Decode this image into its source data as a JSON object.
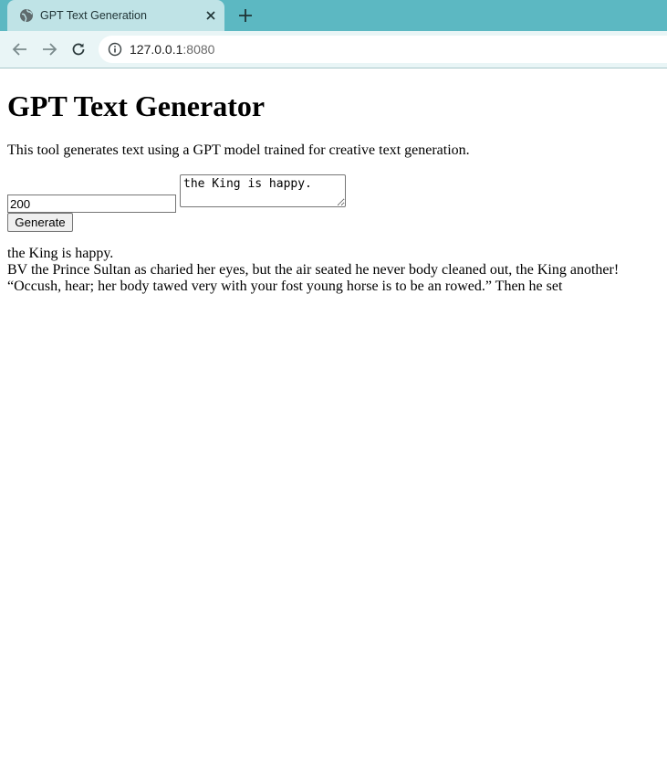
{
  "browser": {
    "tab_title": "GPT Text Generation",
    "url_host": "127.0.0.1",
    "url_port": ":8080"
  },
  "page": {
    "heading": "GPT Text Generator",
    "description": "This tool generates text using a GPT model trained for creative text generation.",
    "form": {
      "length_value": "200",
      "prompt_value": "the King is happy.",
      "generate_label": "Generate"
    },
    "output": {
      "lines": [
        "the King is happy.",
        "BV the Prince Sultan as charied her eyes, but the air seated he never body cleaned out, the King another!",
        "“Occush, hear; her body tawed very with your fost young horse is to be an rowed.” Then he set"
      ]
    }
  }
}
